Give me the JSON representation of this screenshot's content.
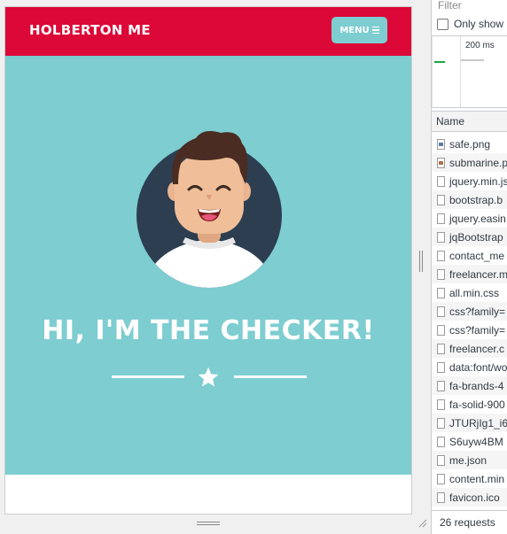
{
  "site": {
    "brand": "HOLBERTON ME",
    "menu_label": "MENU",
    "headline": "HI, I'M THE CHECKER!"
  },
  "colors": {
    "navbar": "#dc0837",
    "masthead": "#7dcdd1",
    "menu_button": "#7dcdd1",
    "avatar_circle": "#2c3e50"
  },
  "devtools": {
    "filter_label": "Filter",
    "only_show_label": "Only show r",
    "timeline_label": "200 ms",
    "column_name": "Name",
    "requests": [
      {
        "name": "safe.png",
        "icon": "image-file-icon"
      },
      {
        "name": "submarine.p",
        "icon": "image-file-icon"
      },
      {
        "name": "jquery.min.js",
        "icon": "script-file-icon"
      },
      {
        "name": "bootstrap.b",
        "icon": "script-file-icon"
      },
      {
        "name": "jquery.easin",
        "icon": "script-file-icon"
      },
      {
        "name": "jqBootstrap",
        "icon": "script-file-icon"
      },
      {
        "name": "contact_me",
        "icon": "script-file-icon"
      },
      {
        "name": "freelancer.m",
        "icon": "script-file-icon"
      },
      {
        "name": "all.min.css",
        "icon": "stylesheet-file-icon"
      },
      {
        "name": "css?family=",
        "icon": "stylesheet-file-icon"
      },
      {
        "name": "css?family=",
        "icon": "stylesheet-file-icon"
      },
      {
        "name": "freelancer.c",
        "icon": "stylesheet-file-icon"
      },
      {
        "name": "data:font/wo",
        "icon": "font-file-icon"
      },
      {
        "name": "fa-brands-4",
        "icon": "font-file-icon"
      },
      {
        "name": "fa-solid-900",
        "icon": "font-file-icon"
      },
      {
        "name": "JTURjIg1_i6",
        "icon": "font-file-icon"
      },
      {
        "name": "S6uyw4BM",
        "icon": "font-file-icon"
      },
      {
        "name": "me.json",
        "icon": "document-file-icon"
      },
      {
        "name": "content.min",
        "icon": "script-file-icon"
      },
      {
        "name": "favicon.ico",
        "icon": "document-file-icon"
      }
    ],
    "status": "26 requests"
  }
}
